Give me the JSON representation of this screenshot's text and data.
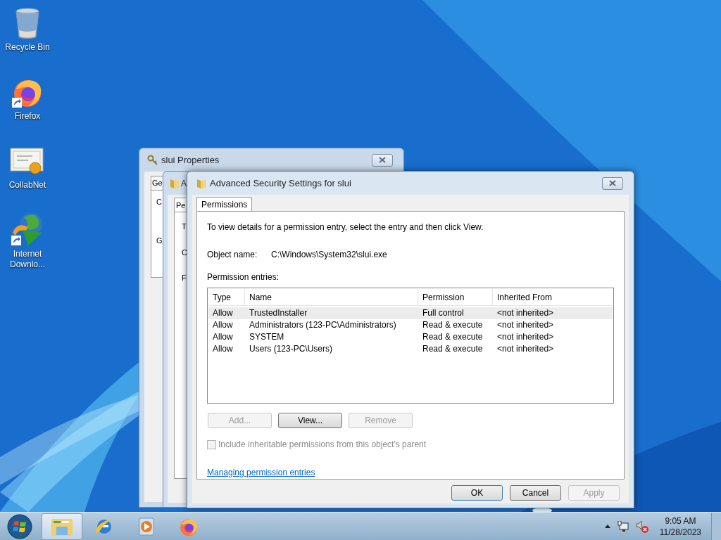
{
  "desktop_icons": [
    {
      "kind": "recycle",
      "label": "Recycle Bin"
    },
    {
      "kind": "firefox",
      "label": "Firefox"
    },
    {
      "kind": "certificate",
      "label": "CollabNet"
    },
    {
      "kind": "downloader",
      "label": "Internet Downlo..."
    }
  ],
  "properties_window": {
    "title": "slui Properties",
    "tab": "Ge",
    "labels": [
      "C",
      "G"
    ]
  },
  "middle_window": {
    "title": "A",
    "tab": "Pe",
    "labels": [
      "T",
      "C",
      "F"
    ]
  },
  "security_window": {
    "title": "Advanced Security Settings for slui",
    "tabs": [
      {
        "label": "Permissions",
        "selected": true
      }
    ],
    "instruction": "To view details for a permission entry, select the entry and then click View.",
    "object_name_label": "Object name:",
    "object_name": "C:\\Windows\\System32\\slui.exe",
    "entries_label": "Permission entries:",
    "table": {
      "columns": [
        "Type",
        "Name",
        "Permission",
        "Inherited From"
      ],
      "rows": [
        {
          "cells": [
            "Allow",
            "TrustedInstaller",
            "Full control",
            "<not inherited>"
          ],
          "selected": true
        },
        {
          "cells": [
            "Allow",
            "Administrators (123-PC\\Administrators)",
            "Read & execute",
            "<not inherited>"
          ],
          "selected": false
        },
        {
          "cells": [
            "Allow",
            "SYSTEM",
            "Read & execute",
            "<not inherited>"
          ],
          "selected": false
        },
        {
          "cells": [
            "Allow",
            "Users (123-PC\\Users)",
            "Read & execute",
            "<not inherited>"
          ],
          "selected": false
        }
      ]
    },
    "list_buttons": [
      {
        "label": "Add...",
        "disabled": true
      },
      {
        "label": "View...",
        "disabled": false
      },
      {
        "label": "Remove",
        "disabled": true
      }
    ],
    "inherit_checkbox": {
      "label": "Include inheritable permissions from this object's parent",
      "checked": false,
      "disabled": true
    },
    "help_link": "Managing permission entries",
    "dialog_buttons": [
      {
        "label": "OK",
        "disabled": false
      },
      {
        "label": "Cancel",
        "disabled": false
      },
      {
        "label": "Apply",
        "disabled": true
      }
    ]
  },
  "taskbar": {
    "items": [
      {
        "kind": "explorer",
        "selected": true
      },
      {
        "kind": "ie",
        "selected": false
      },
      {
        "kind": "media",
        "selected": false
      },
      {
        "kind": "firefox",
        "selected": false
      }
    ],
    "tray": {
      "volume_muted": true,
      "time": "9:05 AM",
      "date": "11/28/2023"
    }
  }
}
